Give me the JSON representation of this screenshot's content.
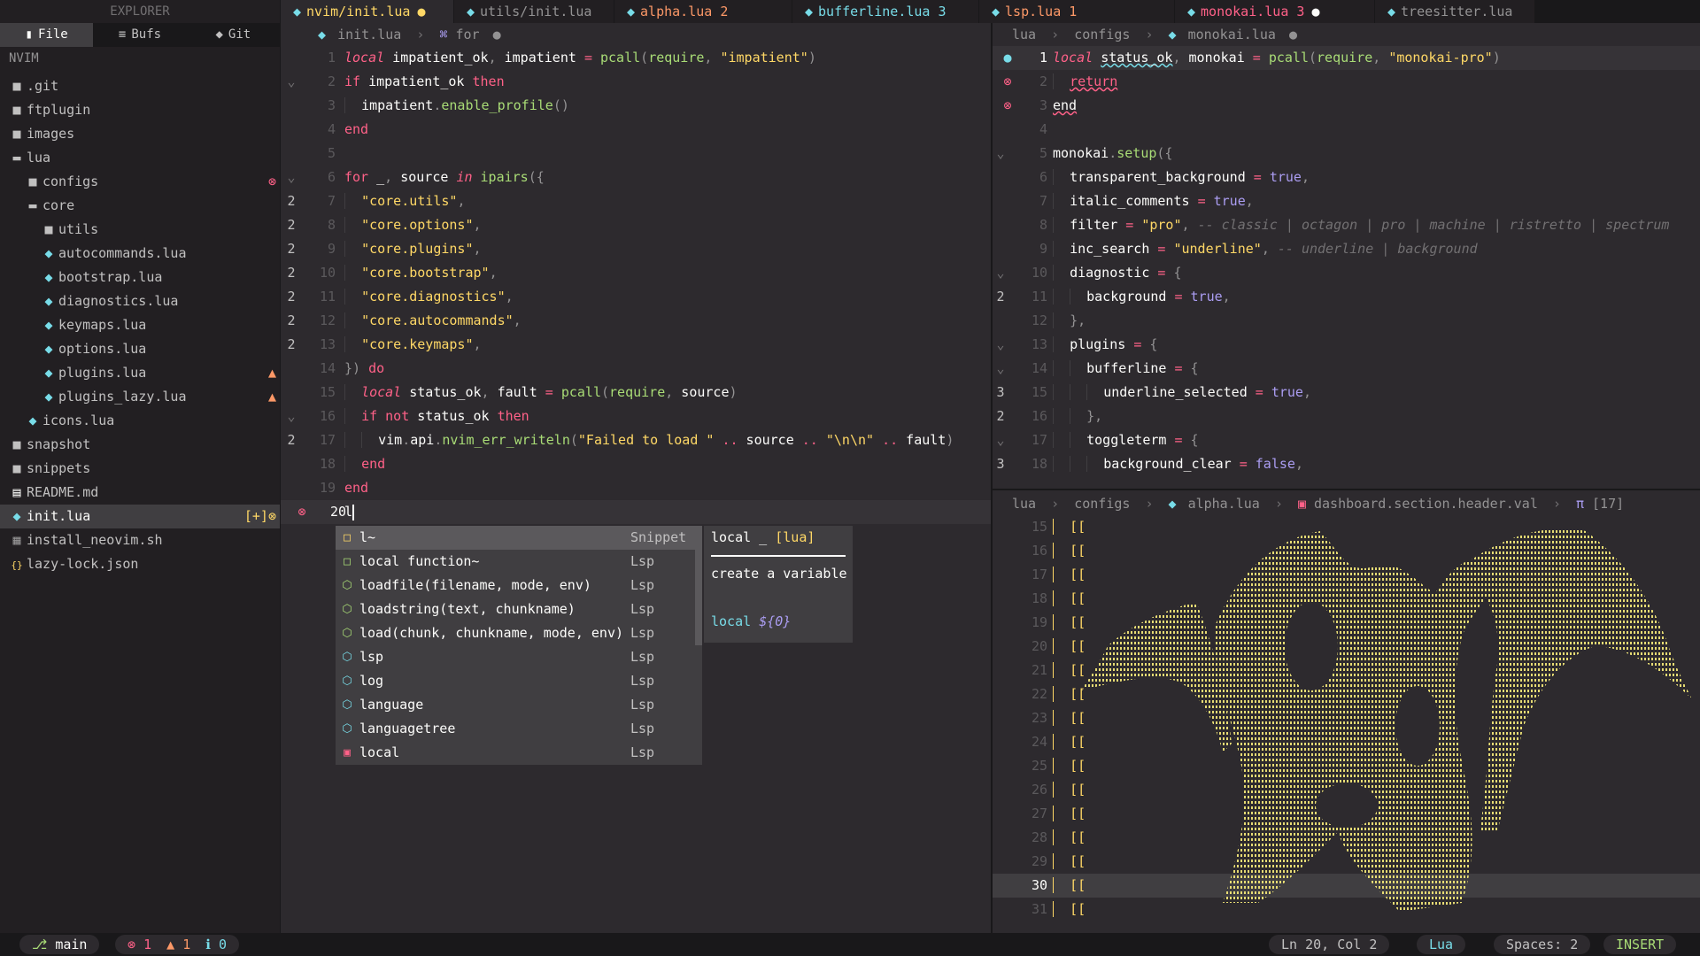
{
  "sidebar": {
    "title": "EXPLORER",
    "tabs": [
      {
        "icon": "file-icon",
        "glyph": "▮",
        "label": "File"
      },
      {
        "icon": "buffers-icon",
        "glyph": "≡",
        "label": "Bufs"
      },
      {
        "icon": "git-icon",
        "glyph": "◆",
        "label": "Git"
      }
    ],
    "root": "NVIM",
    "items": [
      {
        "label": ".git",
        "depth": 1,
        "type": "folder"
      },
      {
        "label": "ftplugin",
        "depth": 1,
        "type": "folder"
      },
      {
        "label": "images",
        "depth": 1,
        "type": "folder"
      },
      {
        "label": "lua",
        "depth": 1,
        "type": "folder-open"
      },
      {
        "label": "configs",
        "depth": 2,
        "type": "folder",
        "badge": "⊗",
        "badge_type": "err"
      },
      {
        "label": "core",
        "depth": 2,
        "type": "folder-open"
      },
      {
        "label": "utils",
        "depth": 3,
        "type": "folder"
      },
      {
        "label": "autocommands.lua",
        "depth": 3,
        "type": "lua"
      },
      {
        "label": "bootstrap.lua",
        "depth": 3,
        "type": "lua"
      },
      {
        "label": "diagnostics.lua",
        "depth": 3,
        "type": "lua"
      },
      {
        "label": "keymaps.lua",
        "depth": 3,
        "type": "lua"
      },
      {
        "label": "options.lua",
        "depth": 3,
        "type": "lua"
      },
      {
        "label": "plugins.lua",
        "depth": 3,
        "type": "lua",
        "badge": "▲",
        "badge_type": "warn"
      },
      {
        "label": "plugins_lazy.lua",
        "depth": 3,
        "type": "lua",
        "badge": "▲",
        "badge_type": "warn"
      },
      {
        "label": "icons.lua",
        "depth": 2,
        "type": "lua"
      },
      {
        "label": "snapshot",
        "depth": 1,
        "type": "folder"
      },
      {
        "label": "snippets",
        "depth": 1,
        "type": "folder"
      },
      {
        "label": "README.md",
        "depth": 1,
        "type": "md"
      },
      {
        "label": "init.lua",
        "depth": 1,
        "type": "lua",
        "selected": true,
        "badge": "[+]⊗",
        "badge_type": "err"
      },
      {
        "label": "install_neovim.sh",
        "depth": 1,
        "type": "sh"
      },
      {
        "label": "lazy-lock.json",
        "depth": 1,
        "type": "json"
      }
    ]
  },
  "tabs": [
    {
      "label": "nvim/init.lua",
      "active": true,
      "dot": "●",
      "style": "warn-tab",
      "width": 195
    },
    {
      "label": "utils/init.lua",
      "width": 180
    },
    {
      "label": "alpha.lua 2",
      "style": "warn-tab",
      "width": 200
    },
    {
      "label": "bufferline.lua 3",
      "style": "info-tab",
      "width": 210
    },
    {
      "label": "lsp.lua 1",
      "style": "warn-tab",
      "width": 220
    },
    {
      "label": "monokai.lua 3",
      "style": "err-tab",
      "dot": "●",
      "width": 225
    },
    {
      "label": "treesitter.lua",
      "width": 180
    }
  ],
  "left_pane": {
    "breadcrumb": [
      "init.lua",
      "for"
    ],
    "breadcrumb_dot": "●"
  },
  "right_top": {
    "breadcrumb": [
      "lua",
      "configs",
      "monokai.lua"
    ],
    "breadcrumb_dot": "●"
  },
  "right_bottom": {
    "breadcrumb": [
      "lua",
      "configs",
      "alpha.lua",
      "dashboard.section.header.val",
      "[17]"
    ]
  },
  "completion": {
    "items": [
      {
        "icon": "□",
        "icon_color": "#ffd866",
        "label": "l~",
        "kind": "Snippet",
        "selected": true
      },
      {
        "icon": "□",
        "icon_color": "#a9dc76",
        "label": "local function~",
        "kind": "Lsp"
      },
      {
        "icon": "⬡",
        "icon_color": "#a9dc76",
        "label": "loadfile(filename, mode, env)",
        "kind": "Lsp"
      },
      {
        "icon": "⬡",
        "icon_color": "#a9dc76",
        "label": "loadstring(text, chunkname)",
        "kind": "Lsp"
      },
      {
        "icon": "⬡",
        "icon_color": "#a9dc76",
        "label": "load(chunk, chunkname, mode, env)",
        "kind": "Lsp"
      },
      {
        "icon": "⬡",
        "icon_color": "#78dce8",
        "label": "lsp",
        "kind": "Lsp"
      },
      {
        "icon": "⬡",
        "icon_color": "#78dce8",
        "label": "log",
        "kind": "Lsp"
      },
      {
        "icon": "⬡",
        "icon_color": "#78dce8",
        "label": "language",
        "kind": "Lsp"
      },
      {
        "icon": "⬡",
        "icon_color": "#78dce8",
        "label": "languagetree",
        "kind": "Lsp"
      },
      {
        "icon": "▣",
        "icon_color": "#ff6188",
        "label": "local",
        "kind": "Lsp"
      }
    ],
    "doc": {
      "title": "local _",
      "title_lang": "[lua]",
      "description": "create a variable",
      "snippet_kw": "local",
      "snippet_body": "${0}"
    }
  },
  "statusbar": {
    "branch_icon": "⎇",
    "branch": "main",
    "errors": "1",
    "warnings": "1",
    "infos": "0",
    "position": "Ln 20, Col 2",
    "language": "Lua",
    "spaces": "Spaces: 2",
    "mode": "INSERT"
  },
  "colors": {
    "background": "#2d2a2e",
    "accent_yellow": "#ffd866",
    "accent_pink": "#ff6188",
    "accent_green": "#a9dc76",
    "accent_cyan": "#78dce8",
    "accent_orange": "#fc9867",
    "accent_purple": "#ab9df2"
  }
}
